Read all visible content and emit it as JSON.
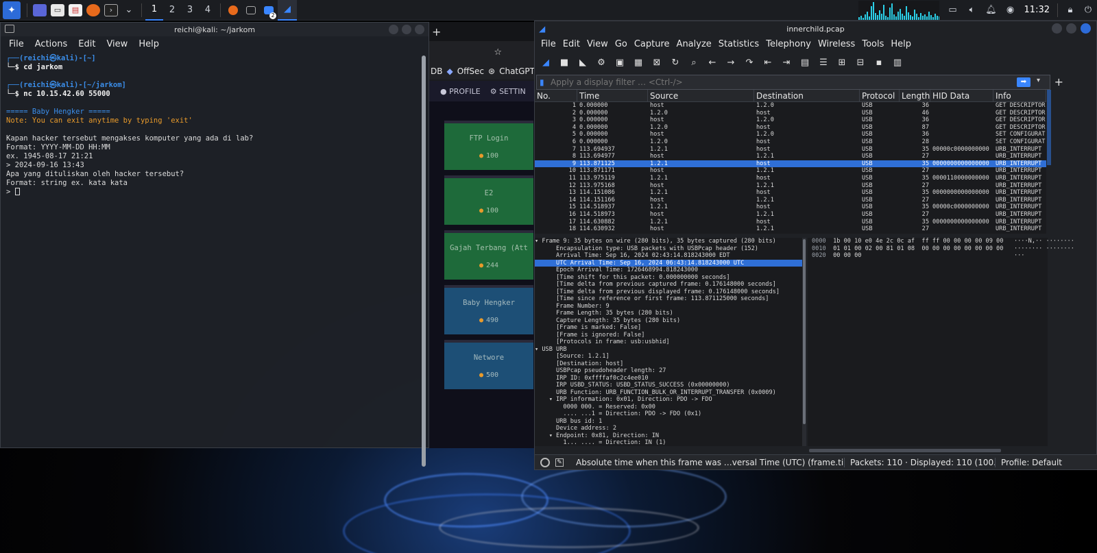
{
  "panel": {
    "workspaces": [
      "1",
      "2",
      "3",
      "4"
    ],
    "active_workspace": "1",
    "clock": "11:32",
    "taskbar_badge": "2"
  },
  "terminal": {
    "title": "reichi@kali: ~/jarkom",
    "menu": [
      "File",
      "Actions",
      "Edit",
      "View",
      "Help"
    ],
    "lines": [
      {
        "cls": "t-prompt1",
        "text": "┌──(reichi㉿kali)-[~]"
      },
      {
        "cls": "t-prompt2",
        "text": "└─$ cd jarkom"
      },
      {
        "cls": "t-plain",
        "text": ""
      },
      {
        "cls": "t-prompt1",
        "text": "┌──(reichi㉿kali)-[~/jarkom]"
      },
      {
        "cls": "t-prompt2",
        "text": "└─$ nc 10.15.42.60 55000"
      },
      {
        "cls": "t-plain",
        "text": ""
      },
      {
        "cls": "t-head",
        "text": "===== Baby Hengker ====="
      },
      {
        "cls": "t-orange",
        "text": "Note: You can exit anytime by typing 'exit'"
      },
      {
        "cls": "t-plain",
        "text": ""
      },
      {
        "cls": "t-plain",
        "text": "Kapan hacker tersebut mengakses komputer yang ada di lab?"
      },
      {
        "cls": "t-plain",
        "text": "Format: YYYY-MM-DD HH:MM"
      },
      {
        "cls": "t-plain",
        "text": "ex. 1945-08-17 21:21"
      },
      {
        "cls": "t-plain",
        "text": "> 2024-09-16 13:43"
      },
      {
        "cls": "t-plain",
        "text": "Apa yang dituliskan oleh hacker tersebut?"
      },
      {
        "cls": "t-plain",
        "text": "Format: string ex. kata kata"
      },
      {
        "cls": "t-cursor",
        "text": "> "
      }
    ]
  },
  "browser": {
    "bookmarks": [
      "DB",
      "OffSec",
      "ChatGPT"
    ],
    "nav": [
      "PROFILE",
      "SETTIN"
    ],
    "challenges": [
      {
        "name": "FTP Login",
        "points": "100",
        "color": "green"
      },
      {
        "name": "E2",
        "points": "100",
        "color": "green"
      },
      {
        "name": "Gajah Terbang (Att",
        "points": "244",
        "color": "green"
      },
      {
        "name": "Baby Hengker",
        "points": "490",
        "color": "blue"
      },
      {
        "name": "Networe",
        "points": "500",
        "color": "blue"
      }
    ]
  },
  "wireshark": {
    "title": "innerchild.pcap",
    "menu": [
      "File",
      "Edit",
      "View",
      "Go",
      "Capture",
      "Analyze",
      "Statistics",
      "Telephony",
      "Wireless",
      "Tools",
      "Help"
    ],
    "filter_placeholder": "Apply a display filter … <Ctrl-/>",
    "columns": [
      "No.",
      "Time",
      "Source",
      "Destination",
      "Protocol",
      "Length",
      "HID Data",
      "Info"
    ],
    "packets": [
      [
        "1",
        "0.000000",
        "host",
        "1.2.0",
        "USB",
        "36",
        "",
        "GET DESCRIPTOR"
      ],
      [
        "2",
        "0.000000",
        "1.2.0",
        "host",
        "USB",
        "46",
        "",
        "GET DESCRIPTOR"
      ],
      [
        "3",
        "0.000000",
        "host",
        "1.2.0",
        "USB",
        "36",
        "",
        "GET DESCRIPTOR"
      ],
      [
        "4",
        "0.000000",
        "1.2.0",
        "host",
        "USB",
        "87",
        "",
        "GET DESCRIPTOR"
      ],
      [
        "5",
        "0.000000",
        "host",
        "1.2.0",
        "USB",
        "36",
        "",
        "SET CONFIGURAT"
      ],
      [
        "6",
        "0.000000",
        "1.2.0",
        "host",
        "USB",
        "28",
        "",
        "SET CONFIGURAT"
      ],
      [
        "7",
        "113.694937",
        "1.2.1",
        "host",
        "USB",
        "35",
        "00000c0000000000",
        "URB_INTERRUPT"
      ],
      [
        "8",
        "113.694977",
        "host",
        "1.2.1",
        "USB",
        "27",
        "",
        "URB_INTERRUPT"
      ],
      [
        "9",
        "113.871125",
        "1.2.1",
        "host",
        "USB",
        "35",
        "0000000000000000",
        "URB_INTERRUPT"
      ],
      [
        "10",
        "113.871171",
        "host",
        "1.2.1",
        "USB",
        "27",
        "",
        "URB_INTERRUPT"
      ],
      [
        "11",
        "113.975119",
        "1.2.1",
        "host",
        "USB",
        "35",
        "0000110000000000",
        "URB_INTERRUPT"
      ],
      [
        "12",
        "113.975168",
        "host",
        "1.2.1",
        "USB",
        "27",
        "",
        "URB_INTERRUPT"
      ],
      [
        "13",
        "114.151086",
        "1.2.1",
        "host",
        "USB",
        "35",
        "0000000000000000",
        "URB_INTERRUPT"
      ],
      [
        "14",
        "114.151166",
        "host",
        "1.2.1",
        "USB",
        "27",
        "",
        "URB_INTERRUPT"
      ],
      [
        "15",
        "114.518937",
        "1.2.1",
        "host",
        "USB",
        "35",
        "00000c0000000000",
        "URB_INTERRUPT"
      ],
      [
        "16",
        "114.518973",
        "host",
        "1.2.1",
        "USB",
        "27",
        "",
        "URB_INTERRUPT"
      ],
      [
        "17",
        "114.630882",
        "1.2.1",
        "host",
        "USB",
        "35",
        "0000000000000000",
        "URB_INTERRUPT"
      ],
      [
        "18",
        "114.630932",
        "host",
        "1.2.1",
        "USB",
        "27",
        "",
        "URB_INTERRUPT"
      ]
    ],
    "selected_packet": "9",
    "details": [
      "▾ Frame 9: 35 bytes on wire (280 bits), 35 bytes captured (280 bits)",
      "      Encapsulation type: USB packets with USBPcap header (152)",
      "      Arrival Time: Sep 16, 2024 02:43:14.818243000 EDT",
      "      UTC Arrival Time: Sep 16, 2024 06:43:14.818243000 UTC",
      "      Epoch Arrival Time: 1726468994.818243000",
      "      [Time shift for this packet: 0.000000000 seconds]",
      "      [Time delta from previous captured frame: 0.176148000 seconds]",
      "      [Time delta from previous displayed frame: 0.176148000 seconds]",
      "      [Time since reference or first frame: 113.871125000 seconds]",
      "      Frame Number: 9",
      "      Frame Length: 35 bytes (280 bits)",
      "      Capture Length: 35 bytes (280 bits)",
      "      [Frame is marked: False]",
      "      [Frame is ignored: False]",
      "      [Protocols in frame: usb:usbhid]",
      "▾ USB URB",
      "      [Source: 1.2.1]",
      "      [Destination: host]",
      "      USBPcap pseudoheader length: 27",
      "      IRP ID: 0xffffaf0c2c4ee010",
      "      IRP USBD_STATUS: USBD_STATUS_SUCCESS (0x00000000)",
      "      URB Function: URB_FUNCTION_BULK_OR_INTERRUPT_TRANSFER (0x0009)",
      "    ▾ IRP information: 0x01, Direction: PDO -> FDO",
      "        0000 000. = Reserved: 0x00",
      "        .... ...1 = Direction: PDO -> FDO (0x1)",
      "      URB bus id: 1",
      "      Device address: 2",
      "    ▾ Endpoint: 0x81, Direction: IN",
      "        1... .... = Direction: IN (1)"
    ],
    "selected_detail": 3,
    "hex": [
      {
        "off": "0000",
        "bytes": "1b 00 10 e0 4e 2c 0c af  ff ff 00 00 00 00 09 00",
        "ascii": "····N,·· ········"
      },
      {
        "off": "0010",
        "bytes": "01 01 00 02 00 81 01 08  00 00 00 00 00 00 00 00",
        "ascii": "········ ········"
      },
      {
        "off": "0020",
        "bytes": "00 00 00",
        "ascii": "···"
      }
    ],
    "status": {
      "message": "Absolute time when this frame was …versal Time (UTC) (frame.time_utc)",
      "packets": "Packets: 110 · Displayed: 110 (100.0%)",
      "profile": "Profile: Default"
    }
  }
}
